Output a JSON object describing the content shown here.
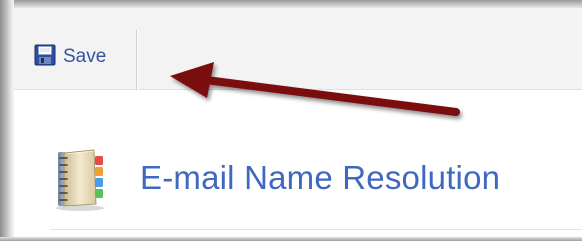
{
  "toolbar": {
    "save_label": "Save",
    "save_icon": "floppy-disk-icon"
  },
  "main": {
    "title": "E-mail Name Resolution",
    "title_icon": "address-book-icon",
    "title_color": "#3f69c0"
  },
  "annotation": {
    "arrow_color": "#7a1010",
    "arrow_icon": "annotation-arrow"
  },
  "colors": {
    "link_blue": "#3553a0",
    "toolbar_bg": "#f3f3f3"
  }
}
